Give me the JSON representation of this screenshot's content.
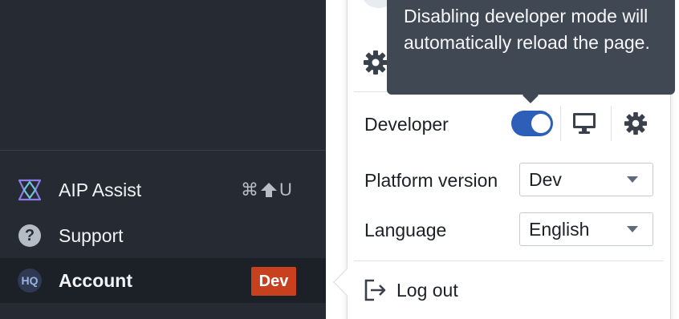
{
  "sidebar": {
    "items": [
      {
        "label": "AIP Assist",
        "icon": "aip-assist-icon",
        "shortcut": {
          "keys": [
            "⌘",
            "⇧"
          ],
          "letter": "U"
        }
      },
      {
        "label": "Support",
        "icon": "help-icon"
      },
      {
        "label": "Account",
        "icon": "avatar",
        "avatar_initials": "HQ",
        "badge": "Dev"
      }
    ]
  },
  "popover": {
    "tooltip": "Disabling developer mode will automatically reload the page.",
    "developer": {
      "label": "Developer",
      "enabled": true
    },
    "platform_version": {
      "label": "Platform version",
      "value": "Dev"
    },
    "language": {
      "label": "Language",
      "value": "English"
    },
    "logout_label": "Log out"
  },
  "colors": {
    "sidebar_bg": "#252a33",
    "toggle_on": "#2d5fb8",
    "badge": "#c9401f",
    "tooltip_bg": "#404854"
  }
}
